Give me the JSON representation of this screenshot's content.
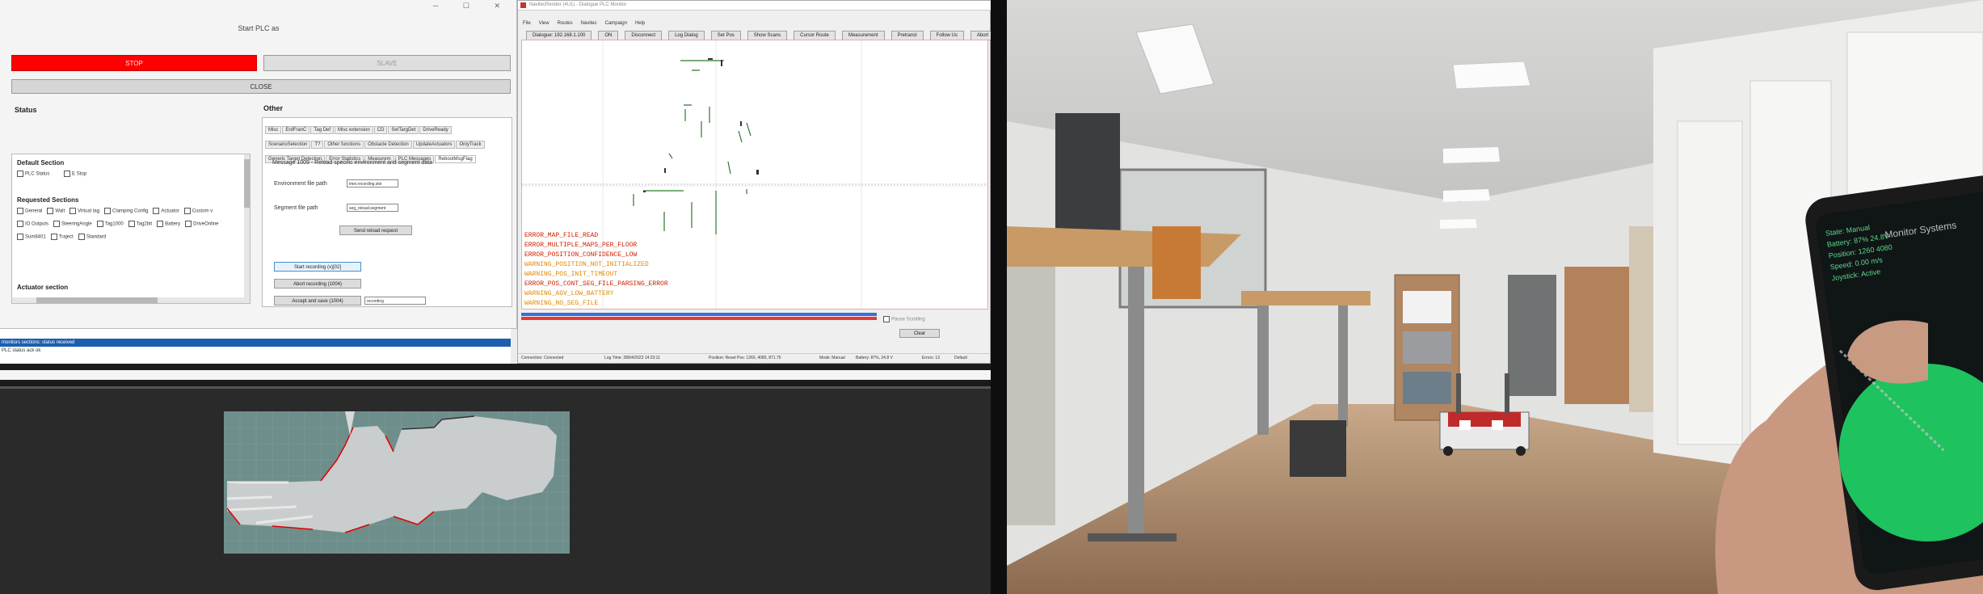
{
  "plc": {
    "title": "Start PLC as",
    "stop_label": "STOP",
    "slave_label": "SLAVE",
    "close_label": "CLOSE",
    "status_heading": "Status",
    "other_heading": "Other",
    "default_section_heading": "Default Section",
    "default_checks": [
      "PLC Status",
      "E Stop"
    ],
    "requested_heading": "Requested Sections",
    "requested_rows": [
      [
        "General",
        "Walt",
        "Virtual tag",
        "Clamping Config",
        "Actuator",
        "Custom v"
      ],
      [
        "IO Outputs",
        "SteeringAngle",
        "Tag1000",
        "Tag2bit",
        "Battery",
        "DriveOnline"
      ],
      [
        "Sum8401",
        "Traject",
        "Standard"
      ]
    ],
    "actuator_heading": "Actuator section",
    "tabs": [
      [
        "Misc",
        "ErdFranC",
        "Tag Def",
        "Misc extension",
        "CD",
        "SetTargDet",
        "DriveReady"
      ],
      [
        "ScenarioSelection",
        "T?",
        "Other functions",
        "Obstacle Detection",
        "UpdateActuators",
        "OnlyTrack"
      ],
      [
        "Generic Target Detection",
        "Error Statistics",
        "Measurem",
        "PLC Messages",
        "RebootMsgFlag"
      ]
    ],
    "message": "Message 1009 - Reload specific environment and segment data",
    "env_label": "Environment file path",
    "env_value": "imei.recording.site",
    "seg_label": "Segment file path",
    "seg_value": "seg_reload.segment",
    "send_reload": "Send reload request",
    "start_rec": "Start recording (x)[02]",
    "abort_rec": "Abort recording (1004)",
    "accept_save": "Accept and save (1004)",
    "rec_name": "recording",
    "log_selected": "monitors sections: status received",
    "log_second": "PLC status ack ok"
  },
  "viewer": {
    "title": "NavitecRender (4U1) - Dialogue PLC Monitor",
    "menu": [
      "File",
      "View",
      "Routes",
      "Navitec",
      "Campaign",
      "Help"
    ],
    "toolbar": [
      "Dialogue: 192.168.1.100",
      "ON",
      "Disconnect",
      "Log Dialog",
      "Set Pos",
      "Show Scans",
      "Cursor Route",
      "Measurement",
      "Pretransl",
      "Follow Us",
      "Abort"
    ],
    "errors": [
      {
        "text": "ERROR_MAP_FILE_READ",
        "color": "#cc2200"
      },
      {
        "text": "ERROR_MULTIPLE_MAPS_PER_FLOOR",
        "color": "#cc2200"
      },
      {
        "text": "ERROR_POSITION_CONFIDENCE_LOW",
        "color": "#cc2200"
      },
      {
        "text": "WARNING_POSITION_NOT_INITIALIZED",
        "color": "#e08a00"
      },
      {
        "text": "WARNING_POS_INIT_TIMEOUT",
        "color": "#e08a00"
      },
      {
        "text": "ERROR_POS_CONT_SEG_FILE_PARSING_ERROR",
        "color": "#cc2200"
      },
      {
        "text": "WARNING_AGV_LOW_BATTERY",
        "color": "#e08a00"
      },
      {
        "text": "WARNING_NO_SEG_FILE",
        "color": "#e08a00"
      }
    ],
    "pause_label": "Pause Scrolling",
    "clear_label": "Clear",
    "status": {
      "connection": "Connection: Connected",
      "log_start": "Log Time: 28/04/2023 14:23:11",
      "position": "Position: Reset Pos: 1260, 4080, 871.75",
      "mode": "Mode: Manual",
      "battery": "Battery: 87%, 24.8 V",
      "errors": "Errors: 13",
      "default": "Default"
    }
  },
  "phone": {
    "header": "Monitor Systems",
    "lines": [
      "State: Manual",
      "Battery: 87% 24.8V",
      "Position: 1260 4080",
      "Speed: 0.00 m/s",
      "Joystick: Active"
    ]
  }
}
